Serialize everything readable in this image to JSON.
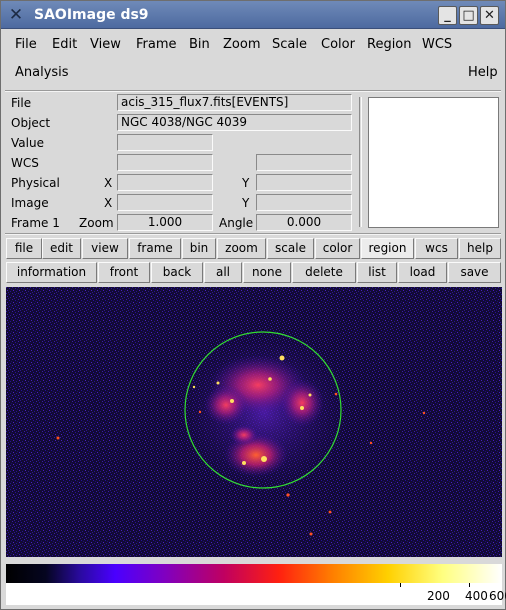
{
  "window": {
    "title": "SAOImage ds9"
  },
  "titlebar_buttons": {
    "minimize": "_",
    "maximize": "□",
    "close": "✕"
  },
  "menu": [
    "File",
    "Edit",
    "View",
    "Frame",
    "Bin",
    "Zoom",
    "Scale",
    "Color",
    "Region",
    "WCS",
    "Analysis",
    "Help"
  ],
  "info": {
    "file_label": "File",
    "file_value": "acis_315_flux7.fits[EVENTS]",
    "object_label": "Object",
    "object_value": "NGC 4038/NGC 4039",
    "value_label": "Value",
    "value_value": "",
    "wcs_label": "WCS",
    "physical_label": "Physical",
    "image_label": "Image",
    "x_label": "X",
    "y_label": "Y",
    "frame_label": "Frame 1",
    "zoom_label": "Zoom",
    "zoom_value": "1.000",
    "angle_label": "Angle",
    "angle_value": "0.000"
  },
  "button_row1": [
    "file",
    "edit",
    "view",
    "frame",
    "bin",
    "zoom",
    "scale",
    "color",
    "region",
    "wcs",
    "help"
  ],
  "button_row1_active": "region",
  "button_row2": [
    "information",
    "front",
    "back",
    "all",
    "none",
    "delete",
    "list",
    "load",
    "save"
  ],
  "colorbar": {
    "tick_labels": [
      "200",
      "400",
      "600"
    ],
    "colormap": "heat-spectrum"
  },
  "colors": {
    "titlebar": "#5873a8",
    "region_circle": "#33dd33",
    "image_background": "#0c0720"
  }
}
